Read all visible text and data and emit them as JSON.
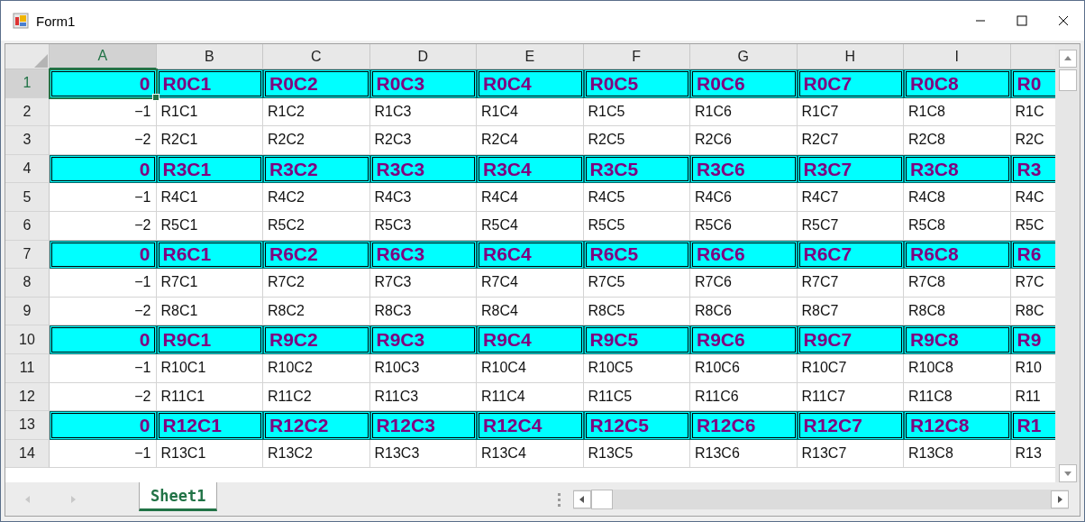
{
  "window": {
    "title": "Form1"
  },
  "columns": [
    {
      "label": "A",
      "selected": true
    },
    {
      "label": "B",
      "selected": false
    },
    {
      "label": "C",
      "selected": false
    },
    {
      "label": "D",
      "selected": false
    },
    {
      "label": "E",
      "selected": false
    },
    {
      "label": "F",
      "selected": false
    },
    {
      "label": "G",
      "selected": false
    },
    {
      "label": "H",
      "selected": false
    },
    {
      "label": "I",
      "selected": false
    }
  ],
  "rows": [
    {
      "header": "1",
      "selected": true,
      "highlighted": true,
      "cells": [
        "0",
        "R0C1",
        "R0C2",
        "R0C3",
        "R0C4",
        "R0C5",
        "R0C6",
        "R0C7",
        "R0C8",
        "R0"
      ]
    },
    {
      "header": "2",
      "selected": false,
      "highlighted": false,
      "cells": [
        "−1",
        "R1C1",
        "R1C2",
        "R1C3",
        "R1C4",
        "R1C5",
        "R1C6",
        "R1C7",
        "R1C8",
        "R1C"
      ]
    },
    {
      "header": "3",
      "selected": false,
      "highlighted": false,
      "cells": [
        "−2",
        "R2C1",
        "R2C2",
        "R2C3",
        "R2C4",
        "R2C5",
        "R2C6",
        "R2C7",
        "R2C8",
        "R2C"
      ]
    },
    {
      "header": "4",
      "selected": false,
      "highlighted": true,
      "cells": [
        "0",
        "R3C1",
        "R3C2",
        "R3C3",
        "R3C4",
        "R3C5",
        "R3C6",
        "R3C7",
        "R3C8",
        "R3"
      ]
    },
    {
      "header": "5",
      "selected": false,
      "highlighted": false,
      "cells": [
        "−1",
        "R4C1",
        "R4C2",
        "R4C3",
        "R4C4",
        "R4C5",
        "R4C6",
        "R4C7",
        "R4C8",
        "R4C"
      ]
    },
    {
      "header": "6",
      "selected": false,
      "highlighted": false,
      "cells": [
        "−2",
        "R5C1",
        "R5C2",
        "R5C3",
        "R5C4",
        "R5C5",
        "R5C6",
        "R5C7",
        "R5C8",
        "R5C"
      ]
    },
    {
      "header": "7",
      "selected": false,
      "highlighted": true,
      "cells": [
        "0",
        "R6C1",
        "R6C2",
        "R6C3",
        "R6C4",
        "R6C5",
        "R6C6",
        "R6C7",
        "R6C8",
        "R6"
      ]
    },
    {
      "header": "8",
      "selected": false,
      "highlighted": false,
      "cells": [
        "−1",
        "R7C1",
        "R7C2",
        "R7C3",
        "R7C4",
        "R7C5",
        "R7C6",
        "R7C7",
        "R7C8",
        "R7C"
      ]
    },
    {
      "header": "9",
      "selected": false,
      "highlighted": false,
      "cells": [
        "−2",
        "R8C1",
        "R8C2",
        "R8C3",
        "R8C4",
        "R8C5",
        "R8C6",
        "R8C7",
        "R8C8",
        "R8C"
      ]
    },
    {
      "header": "10",
      "selected": false,
      "highlighted": true,
      "cells": [
        "0",
        "R9C1",
        "R9C2",
        "R9C3",
        "R9C4",
        "R9C5",
        "R9C6",
        "R9C7",
        "R9C8",
        "R9"
      ]
    },
    {
      "header": "11",
      "selected": false,
      "highlighted": false,
      "cells": [
        "−1",
        "R10C1",
        "R10C2",
        "R10C3",
        "R10C4",
        "R10C5",
        "R10C6",
        "R10C7",
        "R10C8",
        "R10"
      ]
    },
    {
      "header": "12",
      "selected": false,
      "highlighted": false,
      "cells": [
        "−2",
        "R11C1",
        "R11C2",
        "R11C3",
        "R11C4",
        "R11C5",
        "R11C6",
        "R11C7",
        "R11C8",
        "R11"
      ]
    },
    {
      "header": "13",
      "selected": false,
      "highlighted": true,
      "cells": [
        "0",
        "R12C1",
        "R12C2",
        "R12C3",
        "R12C4",
        "R12C5",
        "R12C6",
        "R12C7",
        "R12C8",
        "R1"
      ]
    },
    {
      "header": "14",
      "selected": false,
      "highlighted": false,
      "cells": [
        "−1",
        "R13C1",
        "R13C2",
        "R13C3",
        "R13C4",
        "R13C5",
        "R13C6",
        "R13C7",
        "R13C8",
        "R13"
      ]
    }
  ],
  "sheet_tabs": [
    {
      "label": "Sheet1",
      "selected": true
    }
  ]
}
